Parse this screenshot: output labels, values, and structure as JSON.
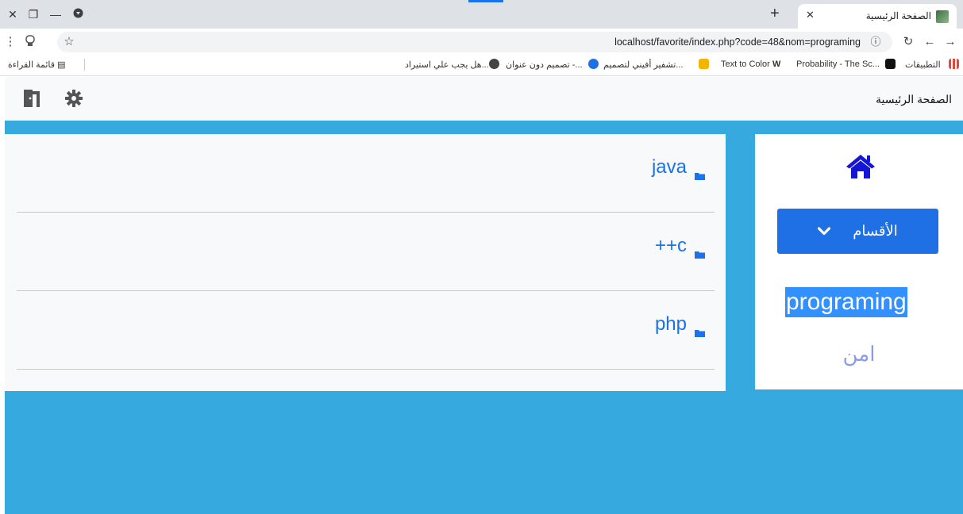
{
  "browser": {
    "tab_title": "الصفحة الرئيسية",
    "url": "localhost/favorite/index.php?code=48&nom=programing",
    "bookmarks": [
      "التطبيقات",
      "Probability - The Sc...",
      "Text to Color",
      "تشفير أفيني لتصميم...",
      "تصميم دون عنوان -...",
      "هل يجب علي استيراد..."
    ],
    "reading_list": "قائمة القراءة"
  },
  "header": {
    "brand": "الصفحة الرئيسية"
  },
  "sidebar": {
    "dropdown_label": "الأقسام",
    "current_category": "programing",
    "other_category": "امن"
  },
  "main": {
    "items": [
      {
        "label": "java"
      },
      {
        "label": "c++"
      },
      {
        "label": "php"
      }
    ]
  },
  "colors": {
    "page_bg": "#36aade",
    "accent": "#1f6fe5",
    "link": "#1a73e8",
    "home_icon": "#1515d6"
  }
}
